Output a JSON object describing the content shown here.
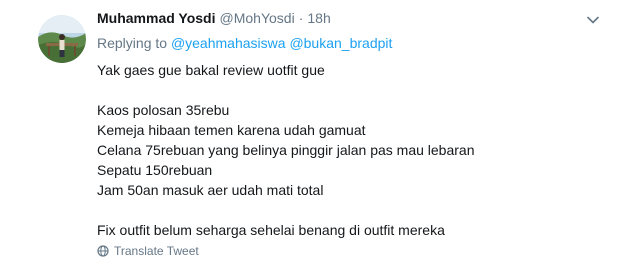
{
  "user": {
    "display_name": "Muhammad Yosdi",
    "handle": "@MohYosdi",
    "separator": "·",
    "time": "18h"
  },
  "reply": {
    "prefix": "Replying to",
    "mentions": [
      "@yeahmahasiswa",
      "@bukan_bradpit"
    ]
  },
  "tweet": {
    "intro": "Yak gaes gue bakal review uotfit gue",
    "items": [
      "Kaos polosan 35rebu",
      "Kemeja hibaan temen karena udah gamuat",
      "Celana 75rebuan yang belinya pinggir jalan pas mau lebaran",
      "Sepatu 150rebuan",
      "Jam 50an masuk aer udah mati total"
    ],
    "closing": "Fix outfit belum seharga sehelai benang di outfit mereka"
  },
  "actions": {
    "translate_label": "Translate Tweet"
  },
  "icons": {
    "caret": "chevron-down-icon",
    "translate": "globe-icon"
  },
  "colors": {
    "text": "#14171a",
    "secondary": "#657786",
    "link": "#1da1f2"
  }
}
